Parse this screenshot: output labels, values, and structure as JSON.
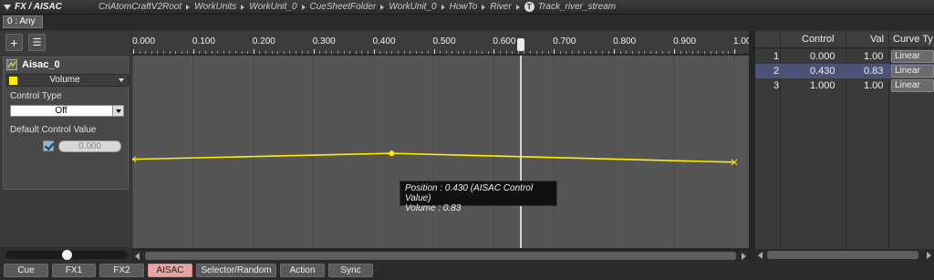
{
  "title": "FX / AISAC",
  "breadcrumbs": [
    "CriAtomCraftV2Root",
    "WorkUnits",
    "WorkUnit_0",
    "CueSheetFolder",
    "WorkUnit_0",
    "HowTo",
    "River"
  ],
  "track_badge": "T",
  "track_name": "Track_river_stream",
  "selector": "0 : Any",
  "toolbar": {
    "add": "+",
    "list": "☰"
  },
  "aisac": {
    "name": "Aisac_0",
    "graph_type": "Volume",
    "graph_color": "#ffee00",
    "control_type_label": "Control Type",
    "control_type_value": "Off",
    "default_control_label": "Default Control Value",
    "default_control_value": "0.000",
    "default_control_checked": true,
    "zoom_slider": 0.5
  },
  "ruler": {
    "ticks": [
      "0.000",
      "0.100",
      "0.200",
      "0.300",
      "0.400",
      "0.500",
      "0.600",
      "0.700",
      "0.800",
      "0.900",
      "1.00"
    ]
  },
  "curve": {
    "points": [
      {
        "control": 0.0,
        "value": 0.85
      },
      {
        "control": 0.43,
        "value": 0.83
      },
      {
        "control": 1.0,
        "value": 0.86
      }
    ],
    "playhead": 0.645
  },
  "tooltip": {
    "line1": "Position : 0.430 (AISAC Control Value)",
    "line2": "Volume : 0.83"
  },
  "table": {
    "headers": {
      "control": "Control",
      "val": "Val",
      "curve": "Curve Ty"
    },
    "rows": [
      {
        "index": "1",
        "control": "0.000",
        "val": "1.00",
        "curve": "Linear"
      },
      {
        "index": "2",
        "control": "0.430",
        "val": "0.83",
        "curve": "Linear"
      },
      {
        "index": "3",
        "control": "1.000",
        "val": "1.00",
        "curve": "Linear"
      }
    ],
    "selected_row": 2
  },
  "tabs": [
    "Cue",
    "FX1",
    "FX2",
    "AISAC",
    "Selector/Random",
    "Action",
    "Sync"
  ],
  "active_tab": "AISAC"
}
